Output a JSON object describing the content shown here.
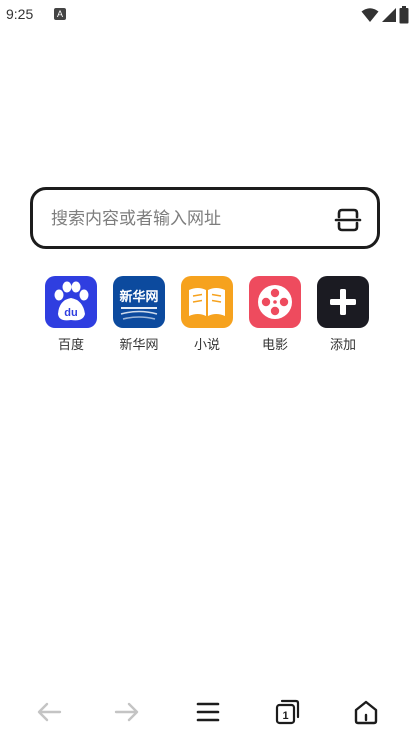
{
  "status_bar": {
    "time": "9:25",
    "notification_icon": "a-letter-icon",
    "icons": [
      "wifi-icon",
      "signal-icon",
      "battery-icon"
    ]
  },
  "search": {
    "placeholder": "搜索内容或者输入网址",
    "value": "",
    "scan_icon": "scan-icon"
  },
  "shortcuts": [
    {
      "label": "百度",
      "icon": "baidu-paw-icon",
      "color": "#2f3ee0"
    },
    {
      "label": "新华网",
      "icon": "xinhuanet-logo-icon",
      "logo_text": "新华网",
      "color": "#0c4a9e"
    },
    {
      "label": "小说",
      "icon": "book-icon",
      "color": "#f6a21e"
    },
    {
      "label": "电影",
      "icon": "film-reel-icon",
      "color": "#ee4b5e"
    },
    {
      "label": "添加",
      "icon": "plus-icon",
      "color": "#1b1b22"
    }
  ],
  "bottom_nav": {
    "tab_count": "1",
    "buttons": [
      "back-arrow-icon",
      "forward-arrow-icon",
      "menu-icon",
      "tabs-icon",
      "home-icon"
    ]
  }
}
